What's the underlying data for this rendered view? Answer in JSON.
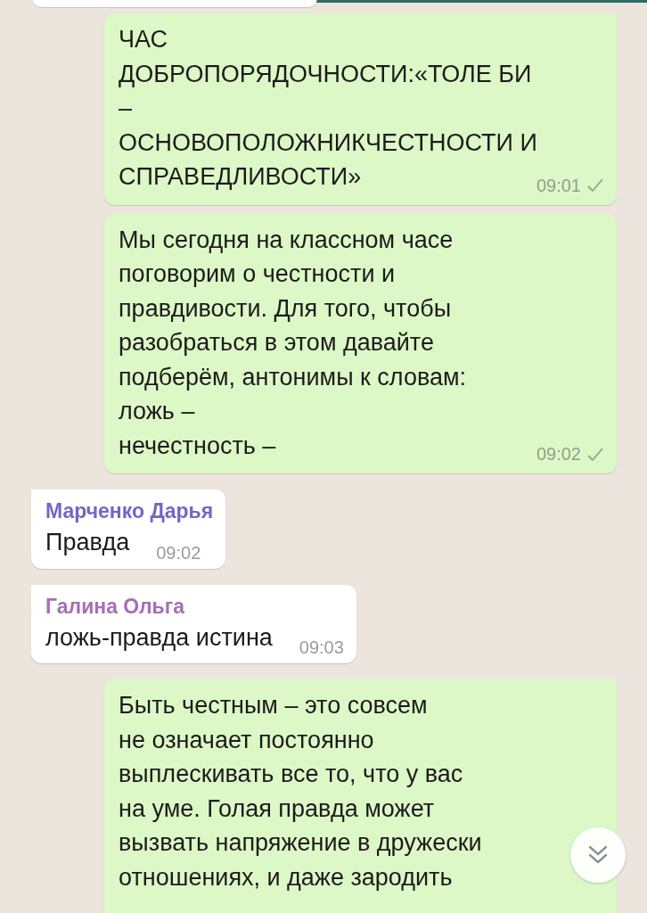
{
  "messages": [
    {
      "kind": "outgoing",
      "text": "ЧАС\nДОБРОПОРЯДОЧНОСТИ:«ТОЛЕ БИ\n–\nОСНОВОПОЛОЖНИКЧЕСТНОСТИ И\nСПРАВЕДЛИВОСТИ»",
      "time": "09:01",
      "delivered": false
    },
    {
      "kind": "outgoing",
      "text": "Мы сегодня на классном часе\nпоговорим о честности и\nправдивости. Для того, чтобы\nразобраться в этом давайте\nподберём, антонимы к словам:\nложь –\nнечестность –",
      "time": "09:02",
      "delivered": false
    },
    {
      "kind": "incoming",
      "sender": "Марченко Дарья",
      "color": "#6f68c4",
      "text": "Правда",
      "time": "09:02"
    },
    {
      "kind": "incoming",
      "sender": "Галина Ольга",
      "color": "#a46fb8",
      "text": "ложь-правда истина",
      "time": "09:03"
    },
    {
      "kind": "outgoing",
      "text": "Быть честным – это совсем\nне означает постоянно\nвыплескивать все то, что у вас\nна уме. Голая правда может\nвызвать напряжение в дружески\nотношениях, и даже зародить"
    }
  ]
}
